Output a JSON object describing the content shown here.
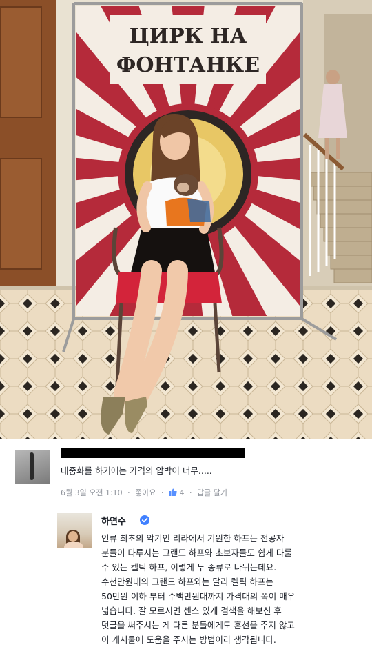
{
  "poster": {
    "line1": "ЦИРК НА",
    "line2": "ФОНТАНКЕ"
  },
  "comment": {
    "text": "대중화를 하기에는 가격의 압박이 너무.....",
    "date": "6월 3일 오전 1:10",
    "like_link": "좋아요",
    "like_count": "4",
    "reply_link": "답글 달기"
  },
  "reply": {
    "name": "하연수",
    "lines": [
      "인류 최초의 악기인 리라에서 기원한 하프는 전공자",
      "분들이 다루시는 그랜드 하프와 초보자들도 쉽게 다룰",
      "수 있는 켈틱 하프, 이렇게 두 종류로 나뉘는데요.",
      "수천만원대의 그랜드 하프와는 달리 켈틱 하프는",
      "50만원 이하 부터 수백만원대까지 가격대의 폭이 매우",
      "넓습니다. 잘 모르시면 센스 있게 검색을 해보신 후",
      "덧글을 써주시는 게 다른 분들에게도 혼선을 주지 않고",
      "이 게시물에 도움을 주시는 방법이라 생각됩니다."
    ]
  },
  "icons": [
    "thumbs-up-icon",
    "verified-badge-icon"
  ],
  "colors": {
    "poster_red": "#b52a3a",
    "meta_gray": "#90949c",
    "verified_blue": "#4080ff",
    "text": "#1d2129"
  }
}
